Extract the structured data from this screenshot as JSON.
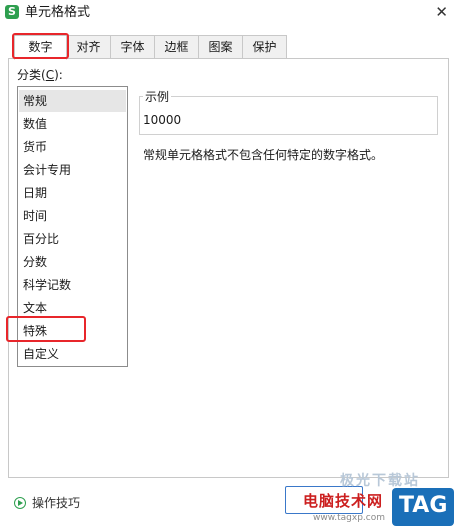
{
  "window": {
    "title": "单元格格式",
    "app_icon_letter": "S",
    "close_glyph": "✕"
  },
  "tabs": [
    {
      "label": "数字",
      "active": true
    },
    {
      "label": "对齐",
      "active": false
    },
    {
      "label": "字体",
      "active": false
    },
    {
      "label": "边框",
      "active": false
    },
    {
      "label": "图案",
      "active": false
    },
    {
      "label": "保护",
      "active": false
    }
  ],
  "category": {
    "label_prefix": "分类(",
    "label_accel": "C",
    "label_suffix": "):",
    "items": [
      {
        "label": "常规",
        "selected": true
      },
      {
        "label": "数值"
      },
      {
        "label": "货币"
      },
      {
        "label": "会计专用"
      },
      {
        "label": "日期"
      },
      {
        "label": "时间"
      },
      {
        "label": "百分比"
      },
      {
        "label": "分数"
      },
      {
        "label": "科学记数"
      },
      {
        "label": "文本"
      },
      {
        "label": "特殊"
      },
      {
        "label": "自定义"
      }
    ]
  },
  "sample": {
    "legend": "示例",
    "value": "10000"
  },
  "description": "常规单元格格式不包含任何特定的数字格式。",
  "footer": {
    "tips_label": "操作技巧"
  },
  "watermark": {
    "site_name": "电脑技术网",
    "url": "www.tagxp.com",
    "logo_text": "TAG",
    "top_text": "极光下载站"
  },
  "colors": {
    "highlight": "#e8262b",
    "app_icon": "#2e9f4f",
    "selected_item": "#e6e6e6"
  }
}
